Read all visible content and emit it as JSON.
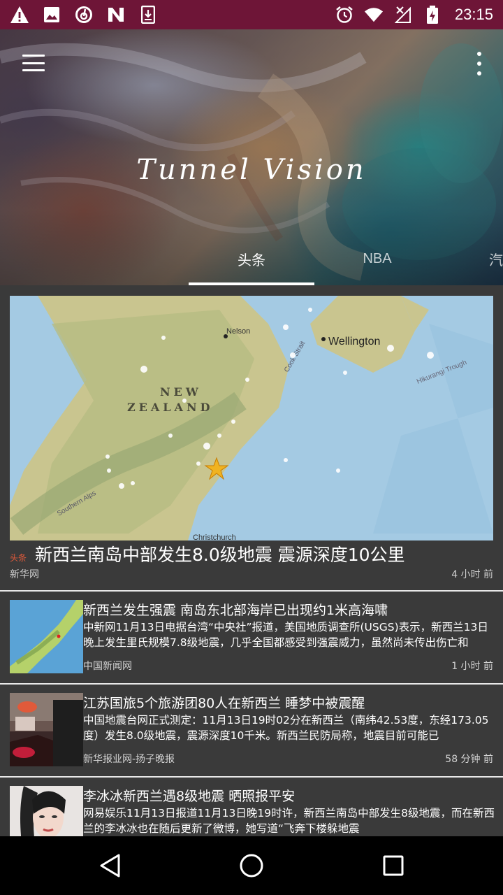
{
  "status_bar": {
    "icons_left": [
      "warning-icon",
      "image-icon",
      "netease-music-icon",
      "news-n-icon",
      "download-icon"
    ],
    "icons_right": [
      "alarm-icon",
      "wifi-icon",
      "signal-off-icon",
      "battery-charging-icon"
    ],
    "time": "23:15"
  },
  "header": {
    "title": "Tunnel Vision",
    "menu_icon": "hamburger-menu-icon",
    "more_icon": "overflow-more-icon"
  },
  "tabs": [
    {
      "label": "头条",
      "selected": true
    },
    {
      "label": "NBA",
      "selected": false
    },
    {
      "label": "汽",
      "selected": false
    }
  ],
  "featured": {
    "image": "new-zealand-earthquake-map",
    "map_labels": {
      "country_line1": "NEW",
      "country_line2": "ZEALAND",
      "city": "Wellington",
      "city2": "Nelson",
      "city3": "Christchurch",
      "strait": "Cook Strait",
      "trough": "Hikurangi Trough",
      "mountains": "Southern Alps"
    },
    "tag": "头条",
    "title": "新西兰南岛中部发生8.0级地震 震源深度10公里",
    "source": "新华网",
    "time": "4 小时 前"
  },
  "news_items": [
    {
      "thumb": "map-thumbnail",
      "title": "新西兰发生强震 南岛东北部海岸已出现约1米高海啸",
      "desc": "中新网11月13日电据台湾“中央社”报道，美国地质调查所(USGS)表示，新西兰13日晚上发生里氏规模7.8级地震，几乎全国都感受到强震威力，虽然尚未传出伤亡和",
      "source": "中国新闻网",
      "time": "1 小时 前"
    },
    {
      "thumb": "bedroom-photo-thumbnail",
      "title": "江苏国旅5个旅游团80人在新西兰 睡梦中被震醒",
      "desc": "中国地震台网正式测定：11月13日19时02分在新西兰（南纬42.53度，东经173.05度）发生8.0级地震，震源深度10千米。新西兰民防局称，地震目前可能已",
      "source": "新华报业网-扬子晚报",
      "time": "58 分钟 前"
    },
    {
      "thumb": "portrait-photo-thumbnail",
      "title": "李冰冰新西兰遇8级地震 晒照报平安",
      "desc": "网易娱乐11月13日报道11月13日晚19时许，新西兰南岛中部发生8级地震，而在新西兰的李冰冰也在随后更新了微博，她写道“飞奔下楼躲地震",
      "source": "",
      "time": ""
    }
  ],
  "nav_bar": {
    "back": "back-triangle-icon",
    "home": "home-circle-icon",
    "recents": "recents-square-icon"
  },
  "colors": {
    "status_bar": "#6e1537",
    "content_bg": "#3a3a3a",
    "tag_color": "#e05a3a"
  }
}
